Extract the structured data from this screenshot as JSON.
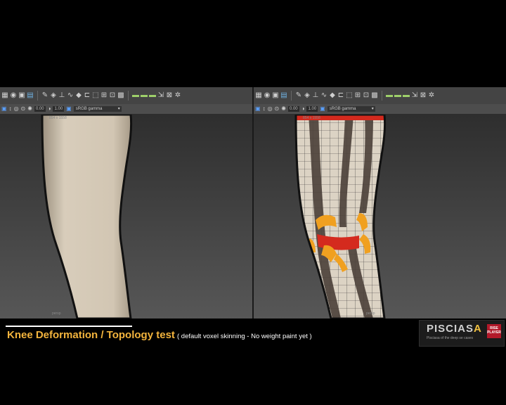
{
  "caption": {
    "title": "Knee Deformation / Topology test",
    "subtitle": "( default voxel skinning - No  weight paint  yet )"
  },
  "logo": {
    "wordmark_main": "PISCIAS",
    "wordmark_accent": "A",
    "tagline": "Pisciasa of the deep se cases",
    "badge": "RISE PLAYER"
  },
  "viewports": {
    "left": {
      "field1": "0.00",
      "field2": "1.00",
      "colorspace": "sRGB gamma",
      "hud_label": "854 x 1558",
      "corner_label": "persp"
    },
    "right": {
      "field1": "0.00",
      "field2": "1.00",
      "colorspace": "sRGB gamma",
      "hud_label": "854 x 1558",
      "corner_label": "persp"
    }
  },
  "colors": {
    "title_accent": "#f3b43d",
    "skin": "#d8cdbb",
    "wire_red": "#d42a1e",
    "wire_orange": "#f0a020",
    "stripe_dark": "#4a3f38"
  }
}
